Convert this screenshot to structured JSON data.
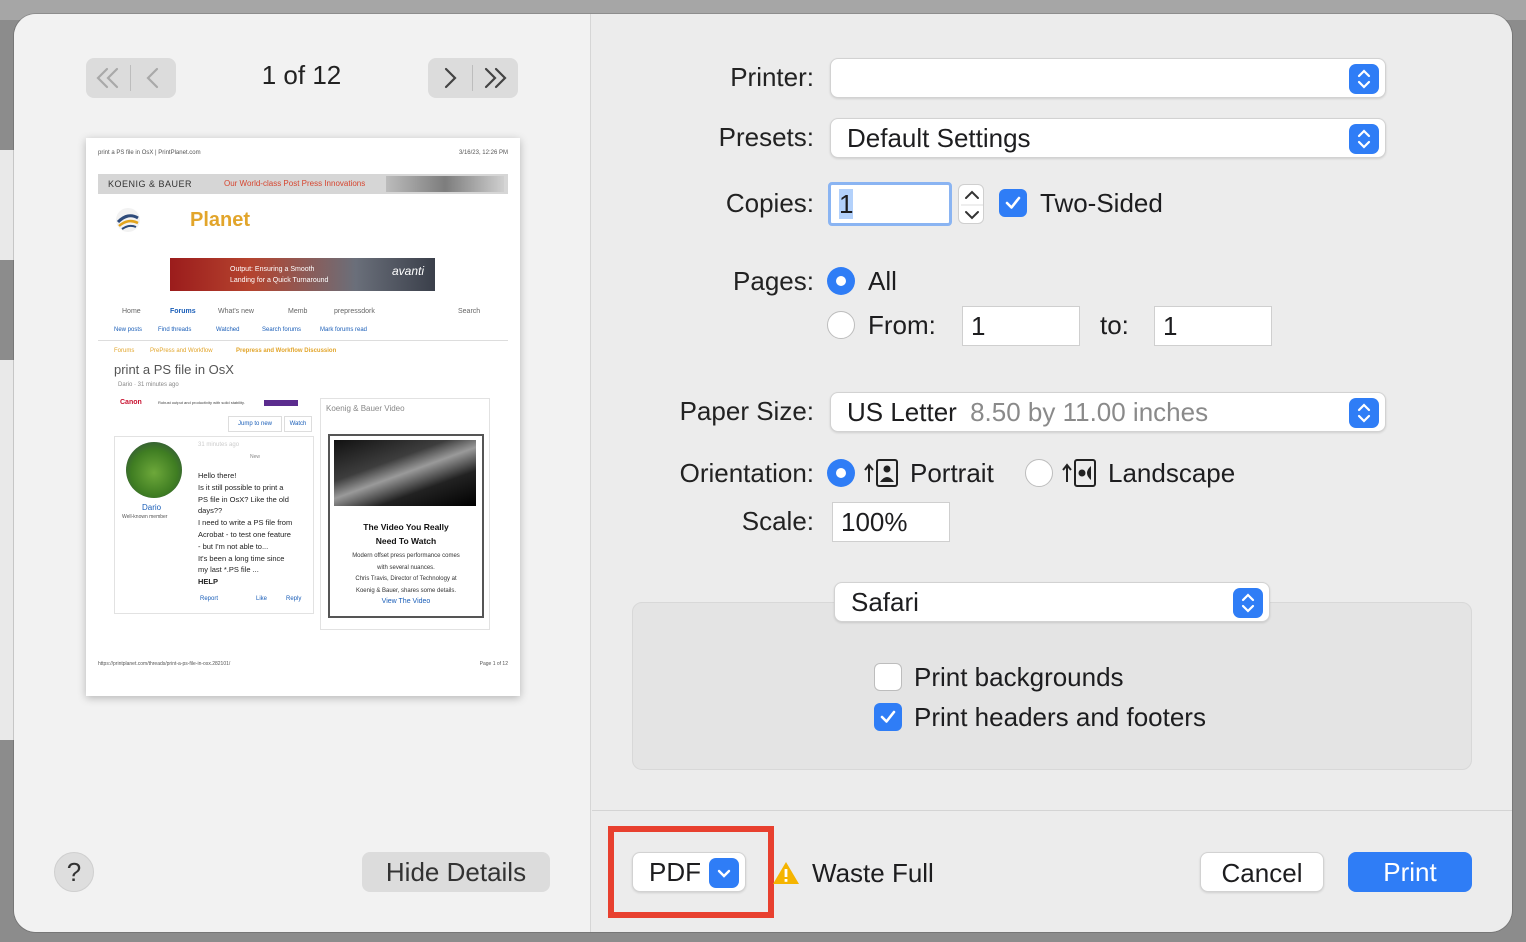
{
  "preview_nav": {
    "page_indicator": "1 of 12"
  },
  "preview_page": {
    "header_left": "print a PS file in OsX | PrintPlanet.com",
    "header_right": "3/16/23, 12:26 PM",
    "banner_brand": "KOENIG & BAUER",
    "banner_tagline": "Our World-class Post Press Innovations",
    "site_name": "Planet",
    "ad_text_1": "Output: Ensuring a Smooth",
    "ad_text_2": "Landing for a Quick Turnaround",
    "ad_brand": "avanti",
    "nav_items": [
      "Home",
      "Forums",
      "What's new",
      "Memb",
      "prepressdork",
      "Search"
    ],
    "subnav_items": [
      "New posts",
      "Find threads",
      "Watched",
      "Search forums",
      "Mark forums read"
    ],
    "breadcrumb": [
      "Forums",
      "PrePress and Workflow",
      "Prepress and Workflow Discussion"
    ],
    "thread_title": "print a PS file in OsX",
    "thread_meta": "Dario · 31 minutes ago",
    "canon_brand": "Canon",
    "canon_text": "Robust output and productivity with solid stability.",
    "jump_label": "Jump to new",
    "watch_label": "Watch",
    "post_time": "31 minutes ago",
    "post_new": "New",
    "author_name": "Dario",
    "author_role": "Well-known member",
    "post_lines": [
      "Hello there!",
      "Is it still possible to print a",
      "PS file in OsX? Like the old",
      "days??",
      "I need to write a PS file from",
      "Acrobat - to test one feature",
      "- but I'm not able to...",
      "It's been a long time since",
      "my last *.PS file ...",
      "HELP"
    ],
    "report_label": "Report",
    "like_label": "Like",
    "reply_label": "Reply",
    "sidebar_title": "Koenig & Bauer Video",
    "video_title_1": "The Video You Really",
    "video_title_2": "Need To Watch",
    "video_desc": [
      "Modern offset press performance comes",
      "with several nuances.",
      "Chris Travis, Director of Technology at",
      "Koenig & Bauer, shares some details."
    ],
    "video_link": "View The Video",
    "footer_left": "https://printplanet.com/threads/print-a-ps-file-in-osx.282101/",
    "footer_right": "Page 1 of 12"
  },
  "left_footer": {
    "help_label": "?",
    "hide_details_label": "Hide Details"
  },
  "settings": {
    "printer_label": "Printer:",
    "printer_value": "",
    "presets_label": "Presets:",
    "presets_value": "Default Settings",
    "copies_label": "Copies:",
    "copies_value": "1",
    "two_sided_label": "Two-Sided",
    "pages_label": "Pages:",
    "pages_all_label": "All",
    "pages_from_label": "From:",
    "pages_from_value": "1",
    "pages_to_label": "to:",
    "pages_to_value": "1",
    "paper_size_label": "Paper Size:",
    "paper_size_value": "US Letter",
    "paper_size_detail": "8.50 by 11.00 inches",
    "orientation_label": "Orientation:",
    "portrait_label": "Portrait",
    "landscape_label": "Landscape",
    "scale_label": "Scale:",
    "scale_value": "100%"
  },
  "app_options": {
    "app_popup_value": "Safari",
    "print_backgrounds_label": "Print backgrounds",
    "print_headers_label": "Print headers and footers"
  },
  "footer": {
    "pdf_label": "PDF",
    "warning_text": "Waste Full",
    "cancel_label": "Cancel",
    "print_label": "Print"
  },
  "colors": {
    "accent": "#2f7df6",
    "highlight_box": "#e8402f",
    "warning": "#f5b400"
  }
}
